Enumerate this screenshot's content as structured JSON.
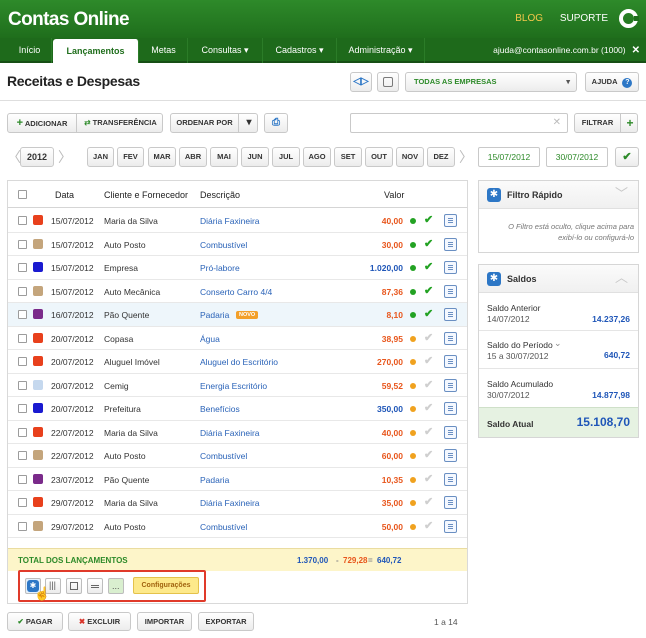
{
  "app": {
    "title": "Contas Online",
    "links": [
      "BLOG",
      "SUPORTE"
    ]
  },
  "nav": {
    "items": [
      "Início",
      "Lançamentos",
      "Metas",
      "Consultas ▾",
      "Cadastros ▾",
      "Administração ▾"
    ],
    "user": "ajuda@contasonline.com.br (1000)"
  },
  "page": {
    "title": "Receitas e Despesas"
  },
  "toolbar": {
    "company": "TODAS AS EMPRESAS",
    "help": "AJUDA",
    "add": "ADICIONAR",
    "transfer": "TRANSFERÊNCIA",
    "order": "ORDENAR POR",
    "search_value": "",
    "filter": "FILTRAR"
  },
  "period": {
    "year": "2012",
    "months": [
      "JAN",
      "FEV",
      "MAR",
      "ABR",
      "MAI",
      "JUN",
      "JUL",
      "AGO",
      "SET",
      "OUT",
      "NOV",
      "DEZ"
    ],
    "start": "15/07/2012",
    "end": "30/07/2012"
  },
  "table": {
    "headers": {
      "date": "Data",
      "client": "Cliente e Fornecedor",
      "desc": "Descrição",
      "value": "Valor"
    },
    "rows": [
      {
        "color": "#e8401c",
        "date": "15/07/2012",
        "client": "Maria da Silva",
        "desc": "Diária Faxineira",
        "value": "40,00",
        "type": "out",
        "status": "green",
        "done": true
      },
      {
        "color": "#c4a57c",
        "date": "15/07/2012",
        "client": "Auto Posto",
        "desc": "Combustível",
        "value": "30,00",
        "type": "out",
        "status": "green",
        "done": true
      },
      {
        "color": "#1a1ad0",
        "date": "15/07/2012",
        "client": "Empresa",
        "desc": "Pró-labore",
        "value": "1.020,00",
        "type": "in",
        "status": "green",
        "done": true
      },
      {
        "color": "#c4a57c",
        "date": "15/07/2012",
        "client": "Auto Mecânica",
        "desc": "Conserto Carro 4/4",
        "value": "87,36",
        "type": "out",
        "status": "green",
        "done": true
      },
      {
        "color": "#7a2a8a",
        "date": "16/07/2012",
        "client": "Pão Quente",
        "desc": "Padaria",
        "value": "8,10",
        "type": "out",
        "status": "green",
        "done": true,
        "badge": "NOVO"
      },
      {
        "color": "#e8401c",
        "date": "20/07/2012",
        "client": "Copasa",
        "desc": "Água",
        "value": "38,95",
        "type": "out",
        "status": "orange",
        "done": false
      },
      {
        "color": "#e8401c",
        "date": "20/07/2012",
        "client": "Aluguel Imóvel",
        "desc": "Aluguel do Escritório",
        "value": "270,00",
        "type": "out",
        "status": "orange",
        "done": false
      },
      {
        "color": "#c5d8ee",
        "date": "20/07/2012",
        "client": "Cemig",
        "desc": "Energia Escritório",
        "value": "59,52",
        "type": "out",
        "status": "orange",
        "done": false
      },
      {
        "color": "#1a1ad0",
        "date": "20/07/2012",
        "client": "Prefeitura",
        "desc": "Benefícios",
        "value": "350,00",
        "type": "in",
        "status": "orange",
        "done": false
      },
      {
        "color": "#e8401c",
        "date": "22/07/2012",
        "client": "Maria da Silva",
        "desc": "Diária Faxineira",
        "value": "40,00",
        "type": "out",
        "status": "orange",
        "done": false
      },
      {
        "color": "#c4a57c",
        "date": "22/07/2012",
        "client": "Auto Posto",
        "desc": "Combustível",
        "value": "60,00",
        "type": "out",
        "status": "orange",
        "done": false
      },
      {
        "color": "#7a2a8a",
        "date": "23/07/2012",
        "client": "Pão Quente",
        "desc": "Padaria",
        "value": "10,35",
        "type": "out",
        "status": "orange",
        "done": false
      },
      {
        "color": "#e8401c",
        "date": "29/07/2012",
        "client": "Maria da Silva",
        "desc": "Diária Faxineira",
        "value": "35,00",
        "type": "out",
        "status": "orange-x",
        "done": false
      },
      {
        "color": "#c4a57c",
        "date": "29/07/2012",
        "client": "Auto Posto",
        "desc": "Combustível",
        "value": "50,00",
        "type": "out",
        "status": "orange-x",
        "done": false
      }
    ],
    "total": {
      "label": "TOTAL DOS LANÇAMENTOS",
      "income": "1.370,00",
      "minus": "-",
      "expense": "729,28",
      "equals": "=",
      "balance": "640,72"
    },
    "config_label": "Configurações"
  },
  "actions": {
    "pay": "PAGAR",
    "delete": "EXCLUIR",
    "import": "IMPORTAR",
    "export": "EXPORTAR",
    "pagination": "1 a 14"
  },
  "filter_panel": {
    "title": "Filtro Rápido",
    "text": "O Filtro está oculto, clique acima para exibí-lo ou configurá-lo"
  },
  "balances": {
    "title": "Saldos",
    "previous": {
      "label": "Saldo Anterior",
      "date": "14/07/2012",
      "value": "14.237,26"
    },
    "period": {
      "label": "Saldo do Período",
      "date": "15 a 30/07/2012",
      "value": "640,72"
    },
    "accumulated": {
      "label": "Saldo Acumulado",
      "date": "30/07/2012",
      "value": "14.877,98"
    },
    "current": {
      "label": "Saldo Atual",
      "value": "15.108,70"
    }
  },
  "colors": {
    "brand_green": "#2d8a29",
    "income_blue": "#1f56b8",
    "expense_orange": "#e8561c",
    "link_blue": "#2a63b8"
  }
}
